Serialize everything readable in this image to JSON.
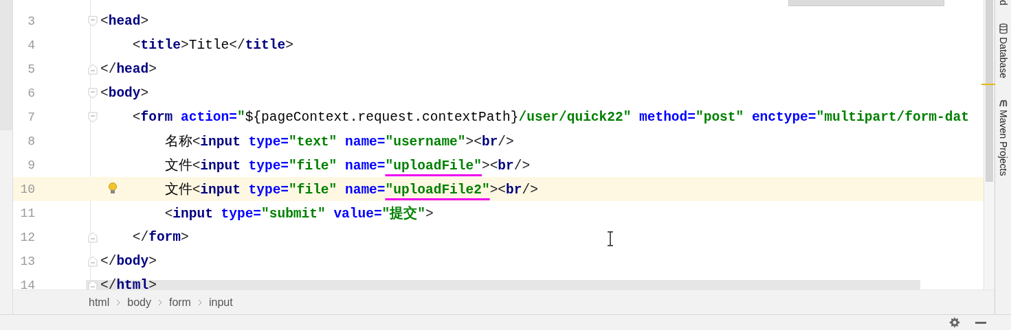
{
  "editor": {
    "lines": [
      {
        "number": "3",
        "kind": "fold-start",
        "current": false,
        "hint": false,
        "tokens": [
          {
            "kind": "punct",
            "text": "<"
          },
          {
            "kind": "tag",
            "text": "head"
          },
          {
            "kind": "punct",
            "text": ">"
          }
        ]
      },
      {
        "number": "4",
        "kind": "plain",
        "current": false,
        "hint": false,
        "tokens": [
          {
            "kind": "punct",
            "text": "    <"
          },
          {
            "kind": "tag",
            "text": "title"
          },
          {
            "kind": "punct",
            "text": ">"
          },
          {
            "kind": "text",
            "text": "Title"
          },
          {
            "kind": "punct",
            "text": "</"
          },
          {
            "kind": "tag",
            "text": "title"
          },
          {
            "kind": "punct",
            "text": ">"
          }
        ]
      },
      {
        "number": "5",
        "kind": "fold-end",
        "current": false,
        "hint": false,
        "tokens": [
          {
            "kind": "punct",
            "text": "</"
          },
          {
            "kind": "tag",
            "text": "head"
          },
          {
            "kind": "punct",
            "text": ">"
          }
        ]
      },
      {
        "number": "6",
        "kind": "fold-start",
        "current": false,
        "hint": false,
        "tokens": [
          {
            "kind": "punct",
            "text": "<"
          },
          {
            "kind": "tag",
            "text": "body"
          },
          {
            "kind": "punct",
            "text": ">"
          }
        ]
      },
      {
        "number": "7",
        "kind": "fold-start",
        "current": false,
        "hint": false,
        "tokens": [
          {
            "kind": "punct",
            "text": "    <"
          },
          {
            "kind": "tag",
            "text": "form"
          },
          {
            "kind": "attr",
            "text": " action="
          },
          {
            "kind": "value",
            "text": "\""
          },
          {
            "kind": "expr",
            "text": "${pageContext.request.contextPath}"
          },
          {
            "kind": "value",
            "text": "/user/quick22\""
          },
          {
            "kind": "attr",
            "text": " method="
          },
          {
            "kind": "value",
            "text": "\"post\""
          },
          {
            "kind": "attr",
            "text": " enctype="
          },
          {
            "kind": "value",
            "text": "\"multipart/form-dat"
          }
        ]
      },
      {
        "number": "8",
        "kind": "plain",
        "current": false,
        "hint": false,
        "tokens": [
          {
            "kind": "text",
            "text": "        名称"
          },
          {
            "kind": "punct",
            "text": "<"
          },
          {
            "kind": "tag",
            "text": "input"
          },
          {
            "kind": "attr",
            "text": " type="
          },
          {
            "kind": "value",
            "text": "\"text\""
          },
          {
            "kind": "attr",
            "text": " name="
          },
          {
            "kind": "value",
            "text": "\"username\""
          },
          {
            "kind": "punct",
            "text": "><"
          },
          {
            "kind": "tag",
            "text": "br"
          },
          {
            "kind": "punct",
            "text": "/>"
          }
        ]
      },
      {
        "number": "9",
        "kind": "plain",
        "current": false,
        "hint": false,
        "tokens": [
          {
            "kind": "text",
            "text": "        文件"
          },
          {
            "kind": "punct",
            "text": "<"
          },
          {
            "kind": "tag",
            "text": "input"
          },
          {
            "kind": "attr",
            "text": " type="
          },
          {
            "kind": "value",
            "text": "\"file\""
          },
          {
            "kind": "attr",
            "text": " name="
          },
          {
            "kind": "value",
            "text": "\"uploadFile\"",
            "underlined": true
          },
          {
            "kind": "punct",
            "text": "><"
          },
          {
            "kind": "tag",
            "text": "br"
          },
          {
            "kind": "punct",
            "text": "/>"
          }
        ]
      },
      {
        "number": "10",
        "kind": "plain",
        "current": true,
        "hint": true,
        "tokens": [
          {
            "kind": "text",
            "text": "        文件"
          },
          {
            "kind": "punct",
            "text": "<"
          },
          {
            "kind": "tag",
            "text": "input"
          },
          {
            "kind": "attr",
            "text": " type="
          },
          {
            "kind": "value",
            "text": "\"file\""
          },
          {
            "kind": "attr",
            "text": " name="
          },
          {
            "kind": "value",
            "text": "\"uploadFile2\"",
            "underlined": true
          },
          {
            "kind": "punct",
            "text": "><"
          },
          {
            "kind": "tag",
            "text": "br"
          },
          {
            "kind": "punct",
            "text": "/>"
          }
        ]
      },
      {
        "number": "11",
        "kind": "plain",
        "current": false,
        "hint": false,
        "tokens": [
          {
            "kind": "punct",
            "text": "        <"
          },
          {
            "kind": "tag",
            "text": "input"
          },
          {
            "kind": "attr",
            "text": " type="
          },
          {
            "kind": "value",
            "text": "\"submit\""
          },
          {
            "kind": "attr",
            "text": " value="
          },
          {
            "kind": "value",
            "text": "\"提交\""
          },
          {
            "kind": "punct",
            "text": ">"
          }
        ]
      },
      {
        "number": "12",
        "kind": "fold-end",
        "current": false,
        "hint": false,
        "tokens": [
          {
            "kind": "punct",
            "text": "    </"
          },
          {
            "kind": "tag",
            "text": "form"
          },
          {
            "kind": "punct",
            "text": ">"
          }
        ]
      },
      {
        "number": "13",
        "kind": "fold-end",
        "current": false,
        "hint": false,
        "tokens": [
          {
            "kind": "punct",
            "text": "</"
          },
          {
            "kind": "tag",
            "text": "body"
          },
          {
            "kind": "punct",
            "text": ">"
          }
        ]
      },
      {
        "number": "14",
        "kind": "fold-end",
        "current": false,
        "hint": false,
        "tokens": [
          {
            "kind": "punct",
            "text": "</"
          },
          {
            "kind": "tag",
            "text": "html"
          },
          {
            "kind": "punct",
            "text": ">"
          }
        ]
      }
    ]
  },
  "breadcrumb": [
    "html",
    "body",
    "form",
    "input"
  ],
  "tool_strip": [
    {
      "kind": "cut",
      "label": "d"
    },
    {
      "kind": "database",
      "label": "Database"
    },
    {
      "kind": "maven",
      "label": "Maven Projects"
    }
  ]
}
